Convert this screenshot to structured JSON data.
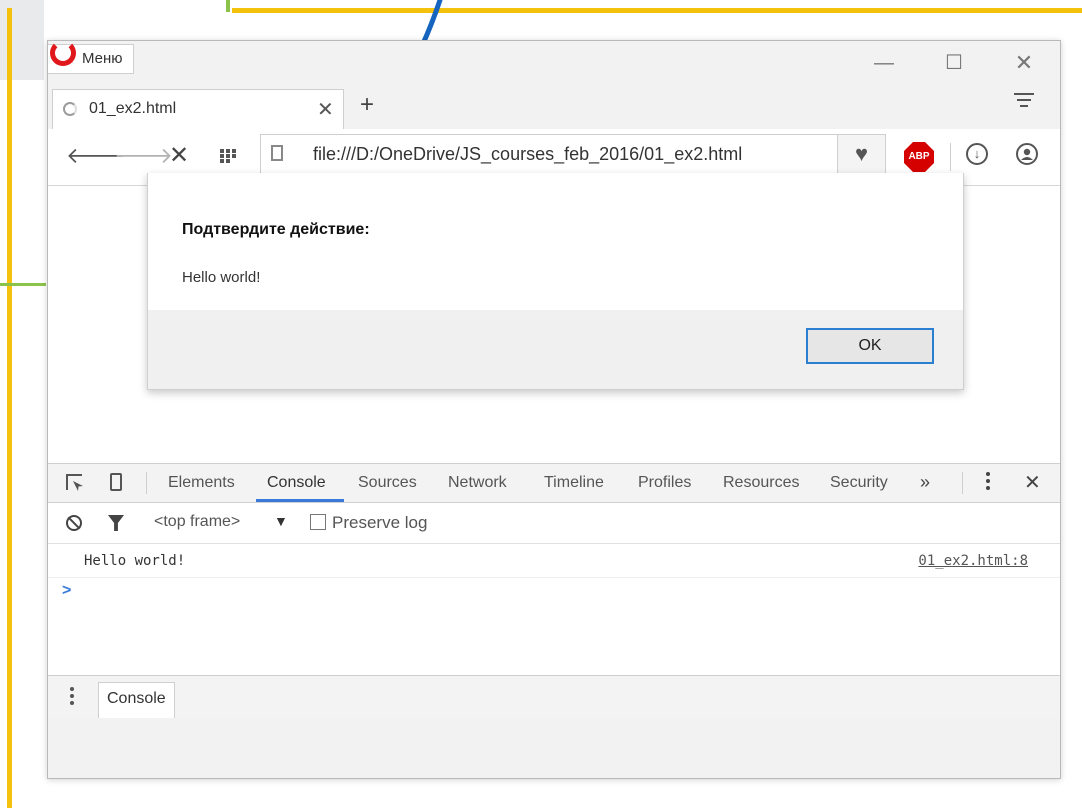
{
  "titlebar": {
    "menu_label": "Меню",
    "minimize_icon": "—",
    "maximize_icon": "☐",
    "close_icon": "✕"
  },
  "tab": {
    "title": "01_ex2.html",
    "close_icon": "✕",
    "new_tab_icon": "+"
  },
  "toolbar": {
    "back_icon": "🡐",
    "forward_icon": "🡒",
    "stop_icon": "✕",
    "url": "file:///D:/OneDrive/JS_courses_feb_2016/01_ex2.html",
    "heart_icon": "♥",
    "abp_label": "ABP",
    "download_icon": "↓"
  },
  "dialog": {
    "title": "Подтвердите действие:",
    "message": "Hello world!",
    "ok_label": "OK"
  },
  "devtools": {
    "tabs": [
      "Elements",
      "Console",
      "Sources",
      "Network",
      "Timeline",
      "Profiles",
      "Resources",
      "Security"
    ],
    "active_tab": "Console",
    "more_icon": "»",
    "close_icon": "✕",
    "frame_selector": "<top frame>",
    "frame_arrow": "▼",
    "preserve_log_label": "Preserve log",
    "log": {
      "message": "Hello world!",
      "source": "01_ex2.html:8"
    },
    "prompt": ">",
    "drawer_tab": "Console"
  },
  "colors": {
    "slide_yellow": "#f4c20d",
    "slide_green": "#8bc34a",
    "slide_blue": "#1565c0",
    "devtools_accent": "#3879d9",
    "abp_red": "#d50000"
  }
}
